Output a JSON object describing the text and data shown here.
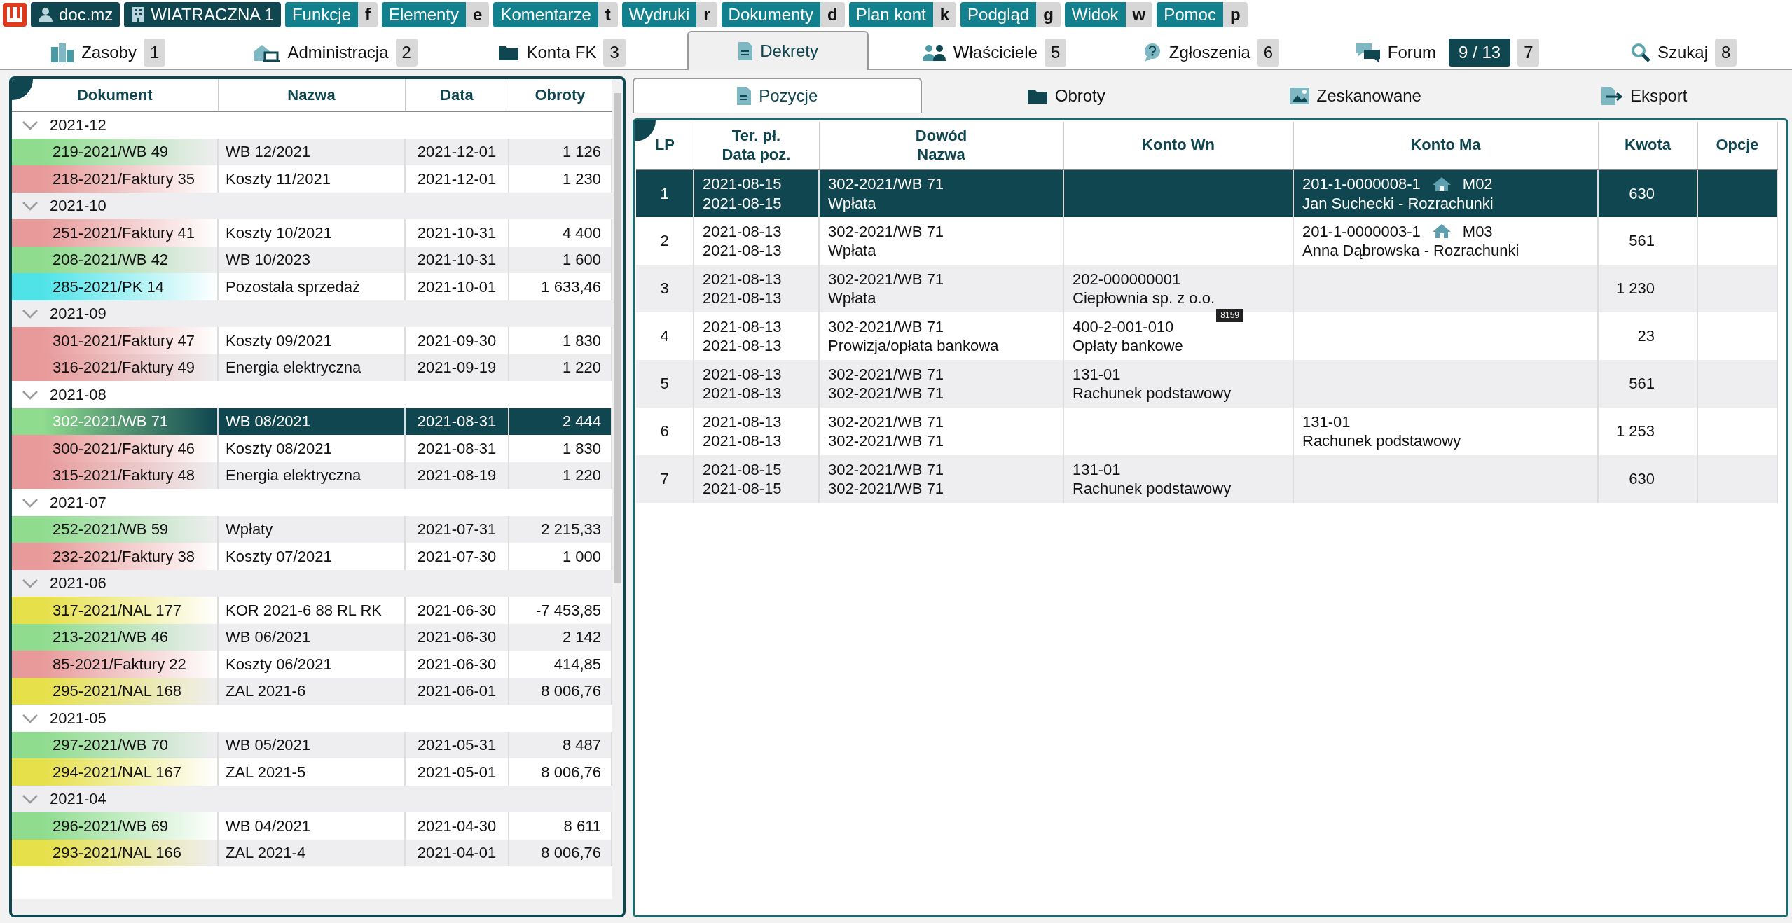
{
  "top_bar": {
    "badges": [
      {
        "kind": "user",
        "label": "doc.mz"
      },
      {
        "kind": "building",
        "label": "WIATRACZNA 1"
      }
    ],
    "menus": [
      {
        "label": "Funkcje",
        "key": "f"
      },
      {
        "label": "Elementy",
        "key": "e"
      },
      {
        "label": "Komentarze",
        "key": "t"
      },
      {
        "label": "Wydruki",
        "key": "r"
      },
      {
        "label": "Dokumenty",
        "key": "d"
      },
      {
        "label": "Plan kont",
        "key": "k"
      },
      {
        "label": "Podgląd",
        "key": "g"
      },
      {
        "label": "Widok",
        "key": "w"
      },
      {
        "label": "Pomoc",
        "key": "p"
      }
    ]
  },
  "tabs": [
    {
      "label": "Zasoby",
      "key": "1",
      "selected": false
    },
    {
      "label": "Administracja",
      "key": "2",
      "selected": false
    },
    {
      "label": "Konta FK",
      "key": "3",
      "selected": false
    },
    {
      "label": "Dekrety",
      "selected": true
    },
    {
      "label": "Właściciele",
      "key": "5",
      "selected": false
    },
    {
      "label": "Zgłoszenia",
      "key": "6",
      "selected": false
    },
    {
      "label": "Forum",
      "counter": "9 / 13",
      "key": "7",
      "selected": false
    },
    {
      "label": "Szukaj",
      "key": "8",
      "selected": false
    }
  ],
  "documents": {
    "columns": [
      "Dokument",
      "Nazwa",
      "Data",
      "Obroty"
    ],
    "groups": [
      {
        "label": "2021-12",
        "expanded": true,
        "rows": [
          {
            "document": "219-2021/WB 49",
            "name": "WB 12/2021",
            "date": "2021-12-01",
            "turnover": "1 126",
            "color": "#8fdc8f",
            "selected": false
          },
          {
            "document": "218-2021/Faktury 35",
            "name": "Koszty 11/2021",
            "date": "2021-12-01",
            "turnover": "1 230",
            "color": "#e89a9a",
            "selected": false
          }
        ]
      },
      {
        "label": "2021-10",
        "expanded": true,
        "rows": [
          {
            "document": "251-2021/Faktury 41",
            "name": "Koszty 10/2021",
            "date": "2021-10-31",
            "turnover": "4 400",
            "color": "#e89a9a",
            "selected": false
          },
          {
            "document": "208-2021/WB 42",
            "name": "WB 10/2023",
            "date": "2021-10-31",
            "turnover": "1 600",
            "color": "#8fdc8f",
            "selected": false
          },
          {
            "document": "285-2021/PK 14",
            "name": "Pozostała sprzedaż",
            "date": "2021-10-01",
            "turnover": "1 633,46",
            "color": "#4fe3e8",
            "selected": false
          }
        ]
      },
      {
        "label": "2021-09",
        "expanded": true,
        "rows": [
          {
            "document": "301-2021/Faktury 47",
            "name": "Koszty 09/2021",
            "date": "2021-09-30",
            "turnover": "1 830",
            "color": "#e89a9a",
            "selected": false
          },
          {
            "document": "316-2021/Faktury 49",
            "name": "Energia elektryczna",
            "date": "2021-09-19",
            "turnover": "1 220",
            "color": "#e89a9a",
            "selected": false
          }
        ]
      },
      {
        "label": "2021-08",
        "expanded": true,
        "rows": [
          {
            "document": "302-2021/WB 71",
            "name": "WB 08/2021",
            "date": "2021-08-31",
            "turnover": "2 444",
            "color": "#8fdc8f",
            "selected": true
          },
          {
            "document": "300-2021/Faktury 46",
            "name": "Koszty 08/2021",
            "date": "2021-08-31",
            "turnover": "1 830",
            "color": "#e89a9a",
            "selected": false
          },
          {
            "document": "315-2021/Faktury 48",
            "name": "Energia elektryczna",
            "date": "2021-08-19",
            "turnover": "1 220",
            "color": "#e89a9a",
            "selected": false
          }
        ]
      },
      {
        "label": "2021-07",
        "expanded": true,
        "rows": [
          {
            "document": "252-2021/WB 59",
            "name": "Wpłaty",
            "date": "2021-07-31",
            "turnover": "2 215,33",
            "color": "#8fdc8f",
            "selected": false
          },
          {
            "document": "232-2021/Faktury 38",
            "name": "Koszty 07/2021",
            "date": "2021-07-30",
            "turnover": "1 000",
            "color": "#e89a9a",
            "selected": false
          }
        ]
      },
      {
        "label": "2021-06",
        "expanded": true,
        "rows": [
          {
            "document": "317-2021/NAL 177",
            "name": "KOR 2021-6 88 RL RK",
            "date": "2021-06-30",
            "turnover": "-7 453,85",
            "color": "#e6e04a",
            "selected": false
          },
          {
            "document": "213-2021/WB 46",
            "name": "WB 06/2021",
            "date": "2021-06-30",
            "turnover": "2 142",
            "color": "#8fdc8f",
            "selected": false
          },
          {
            "document": "85-2021/Faktury 22",
            "name": "Koszty 06/2021",
            "date": "2021-06-30",
            "turnover": "414,85",
            "color": "#e89a9a",
            "selected": false
          },
          {
            "document": "295-2021/NAL 168",
            "name": "ZAL 2021-6",
            "date": "2021-06-01",
            "turnover": "8 006,76",
            "color": "#e6e04a",
            "selected": false
          }
        ]
      },
      {
        "label": "2021-05",
        "expanded": true,
        "rows": [
          {
            "document": "297-2021/WB 70",
            "name": "WB 05/2021",
            "date": "2021-05-31",
            "turnover": "8 487",
            "color": "#8fdc8f",
            "selected": false
          },
          {
            "document": "294-2021/NAL 167",
            "name": "ZAL 2021-5",
            "date": "2021-05-01",
            "turnover": "8 006,76",
            "color": "#e6e04a",
            "selected": false
          }
        ]
      },
      {
        "label": "2021-04",
        "expanded": true,
        "rows": [
          {
            "document": "296-2021/WB 69",
            "name": "WB 04/2021",
            "date": "2021-04-30",
            "turnover": "8 611",
            "color": "#8fdc8f",
            "selected": false
          },
          {
            "document": "293-2021/NAL 166",
            "name": "ZAL 2021-4",
            "date": "2021-04-01",
            "turnover": "8 006,76",
            "color": "#e6e04a",
            "selected": false
          }
        ]
      }
    ]
  },
  "detail_tabs": [
    {
      "label": "Pozycje",
      "selected": true
    },
    {
      "label": "Obroty",
      "selected": false
    },
    {
      "label": "Zeskanowane",
      "selected": false
    },
    {
      "label": "Eksport",
      "selected": false
    }
  ],
  "positions": {
    "columns": [
      [
        "LP"
      ],
      [
        "Ter. pł.",
        "Data poz."
      ],
      [
        "Dowód",
        "Nazwa"
      ],
      [
        "Konto Wn"
      ],
      [
        "Konto Ma"
      ],
      [
        "Kwota"
      ],
      [
        "Opcje"
      ]
    ],
    "rows": [
      {
        "lp": "1",
        "dates": [
          "2021-08-15",
          "2021-08-15"
        ],
        "proof": [
          "302-2021/WB 71",
          "Wpłata"
        ],
        "credit": {
          "code": "201-1-0000008-1",
          "tag": "M02",
          "name": "Jan Suchecki - Rozrachunki"
        },
        "amount": "630",
        "selected": true
      },
      {
        "lp": "2",
        "dates": [
          "2021-08-13",
          "2021-08-13"
        ],
        "proof": [
          "302-2021/WB 71",
          "Wpłata"
        ],
        "credit": {
          "code": "201-1-0000003-1",
          "tag": "M03",
          "name": "Anna Dąbrowska - Rozrachunki"
        },
        "amount": "561",
        "selected": false
      },
      {
        "lp": "3",
        "dates": [
          "2021-08-13",
          "2021-08-13"
        ],
        "proof": [
          "302-2021/WB 71",
          "Wpłata"
        ],
        "debit": [
          "202-000000001",
          "Ciepłownia sp. z o.o."
        ],
        "debit_tooltip": "8159",
        "amount": "1 230",
        "selected": false
      },
      {
        "lp": "4",
        "dates": [
          "2021-08-13",
          "2021-08-13"
        ],
        "proof": [
          "302-2021/WB 71",
          "Prowizja/opłata bankowa"
        ],
        "debit": [
          "400-2-001-010",
          "Opłaty bankowe"
        ],
        "amount": "23",
        "selected": false
      },
      {
        "lp": "5",
        "dates": [
          "2021-08-13",
          "2021-08-13"
        ],
        "proof": [
          "302-2021/WB 71",
          "302-2021/WB 71"
        ],
        "debit": [
          "131-01",
          "Rachunek podstawowy"
        ],
        "amount": "561",
        "selected": false
      },
      {
        "lp": "6",
        "dates": [
          "2021-08-13",
          "2021-08-13"
        ],
        "proof": [
          "302-2021/WB 71",
          "302-2021/WB 71"
        ],
        "credit": {
          "code": "131-01",
          "name": "Rachunek podstawowy"
        },
        "amount": "1 253",
        "selected": false
      },
      {
        "lp": "7",
        "dates": [
          "2021-08-15",
          "2021-08-15"
        ],
        "proof": [
          "302-2021/WB 71",
          "302-2021/WB 71"
        ],
        "debit": [
          "131-01",
          "Rachunek podstawowy"
        ],
        "amount": "630",
        "selected": false
      }
    ]
  }
}
